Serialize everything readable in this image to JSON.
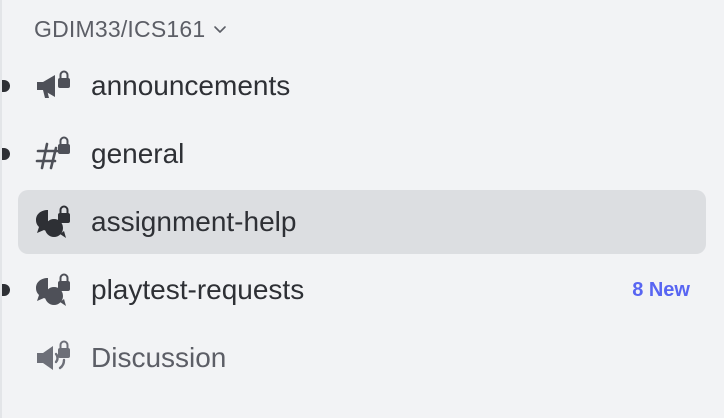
{
  "category": {
    "label": "GDIM33/ICS161",
    "toggle_icon": "chevron-down-icon"
  },
  "channels": [
    {
      "label": "announcements",
      "icon": "announcement-lock-icon",
      "unread": true,
      "selected": false
    },
    {
      "label": "general",
      "icon": "hashtag-lock-icon",
      "unread": true,
      "selected": false
    },
    {
      "label": "assignment-help",
      "icon": "forum-lock-icon",
      "unread": false,
      "selected": true
    },
    {
      "label": "playtest-requests",
      "icon": "forum-lock-icon",
      "unread": true,
      "selected": false,
      "badge": "8 New"
    },
    {
      "label": "Discussion",
      "icon": "stage-lock-icon",
      "unread": false,
      "selected": false
    }
  ],
  "colors": {
    "background": "#f2f3f5",
    "selected": "#dcdee1",
    "text": "#2e3035",
    "muted_text": "#5c5e66",
    "badge": "#5865f2"
  }
}
